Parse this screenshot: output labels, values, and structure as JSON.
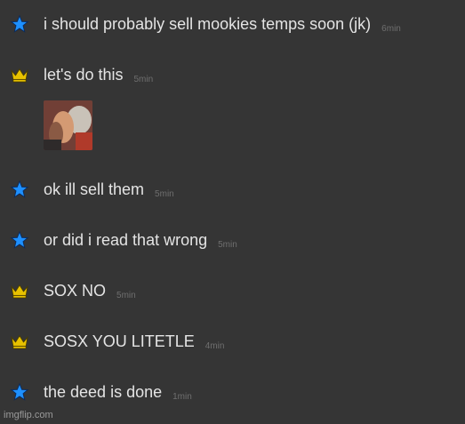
{
  "messages": [
    {
      "badge": "blue-star-icon",
      "text": "i should probably sell mookies temps soon (jk)",
      "time": "6min"
    },
    {
      "badge": "gold-crown-icon",
      "text": "let's do this",
      "time": "5min"
    },
    {
      "badge": "blue-star-icon",
      "text": "ok ill sell them",
      "time": "5min"
    },
    {
      "badge": "blue-star-icon",
      "text": "or did i read that wrong",
      "time": "5min"
    },
    {
      "badge": "gold-crown-icon",
      "text": "SOX NO",
      "time": "5min"
    },
    {
      "badge": "gold-crown-icon",
      "text": "SOSX YOU LITETLE",
      "time": "4min"
    },
    {
      "badge": "blue-star-icon",
      "text": "the deed is done",
      "time": "1min"
    }
  ],
  "watermark": "imgflip.com",
  "colors": {
    "background": "#353535",
    "text": "#e4e4e4",
    "timestamp": "#6f6f6f",
    "star": "#1e90ff",
    "crown": "#e8c200"
  }
}
